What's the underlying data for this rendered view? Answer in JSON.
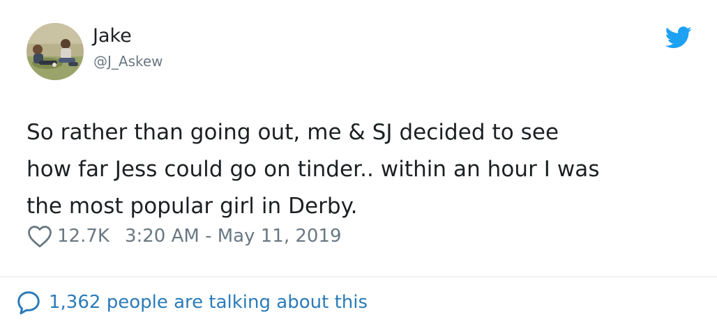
{
  "tweet": {
    "author": {
      "name": "Jake",
      "handle": "@J_Askew"
    },
    "text": "So rather than going out, me & SJ decided to see\nhow far Jess could go on tinder.. within an hour I was\nthe most popular girl in Derby.",
    "likes": "12.7K",
    "timestamp": "3:20 AM - May 11, 2019",
    "talking": "1,362 people are talking about this"
  },
  "icons": {
    "brand": "twitter-bird-icon",
    "like": "heart-icon",
    "talking": "speech-bubble-icon"
  },
  "colors": {
    "brand": "#1da1f2",
    "text": "#1c2022",
    "muted": "#697882",
    "link": "#2b7bb9",
    "divider": "#e1e8ed"
  }
}
